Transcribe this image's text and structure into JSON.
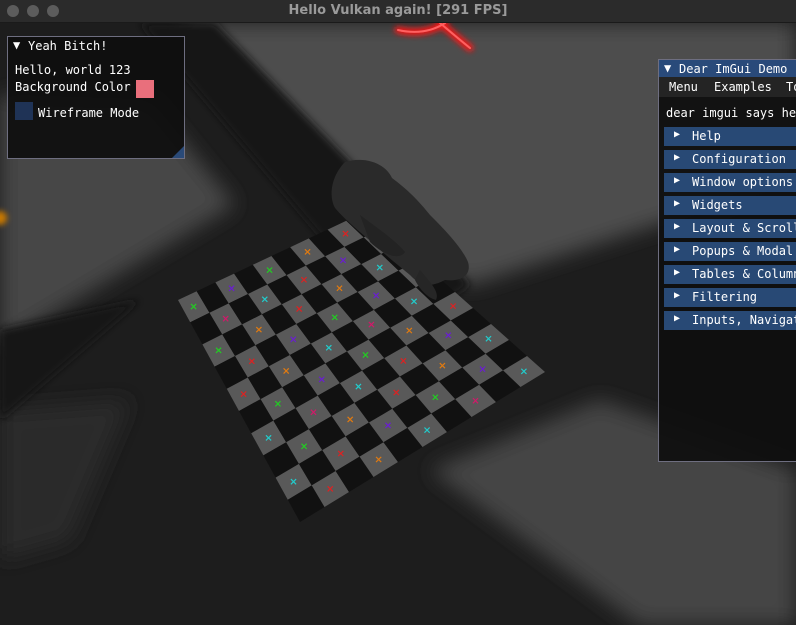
{
  "window": {
    "title": "Hello Vulkan again!  [291 FPS]"
  },
  "yeah_window": {
    "title": "Yeah Bitch!",
    "hello_text": "Hello, world 123",
    "bg_color_label": "Background Color",
    "bg_color_value": "#e96f7c",
    "wireframe_label": "Wireframe Mode",
    "wireframe_checked": false
  },
  "demo_window": {
    "title": "Dear ImGui Demo",
    "menu": [
      "Menu",
      "Examples",
      "To"
    ],
    "intro_text": "dear imgui says hel",
    "sections": [
      "Help",
      "Configuration",
      "Window options",
      "Widgets",
      "Layout & Scroll",
      "Popups & Modal",
      "Tables & Column",
      "Filtering",
      "Inputs, Navigat"
    ]
  },
  "colors": {
    "imgui_header": "#284975",
    "imgui_title_active": "#294a7a",
    "checker_light": "#595959",
    "checker_dark": "#111111",
    "glow": "#ff1414"
  },
  "icons": {
    "collapse_arrow": "triangle-down",
    "tree_arrow": "triangle-right"
  }
}
